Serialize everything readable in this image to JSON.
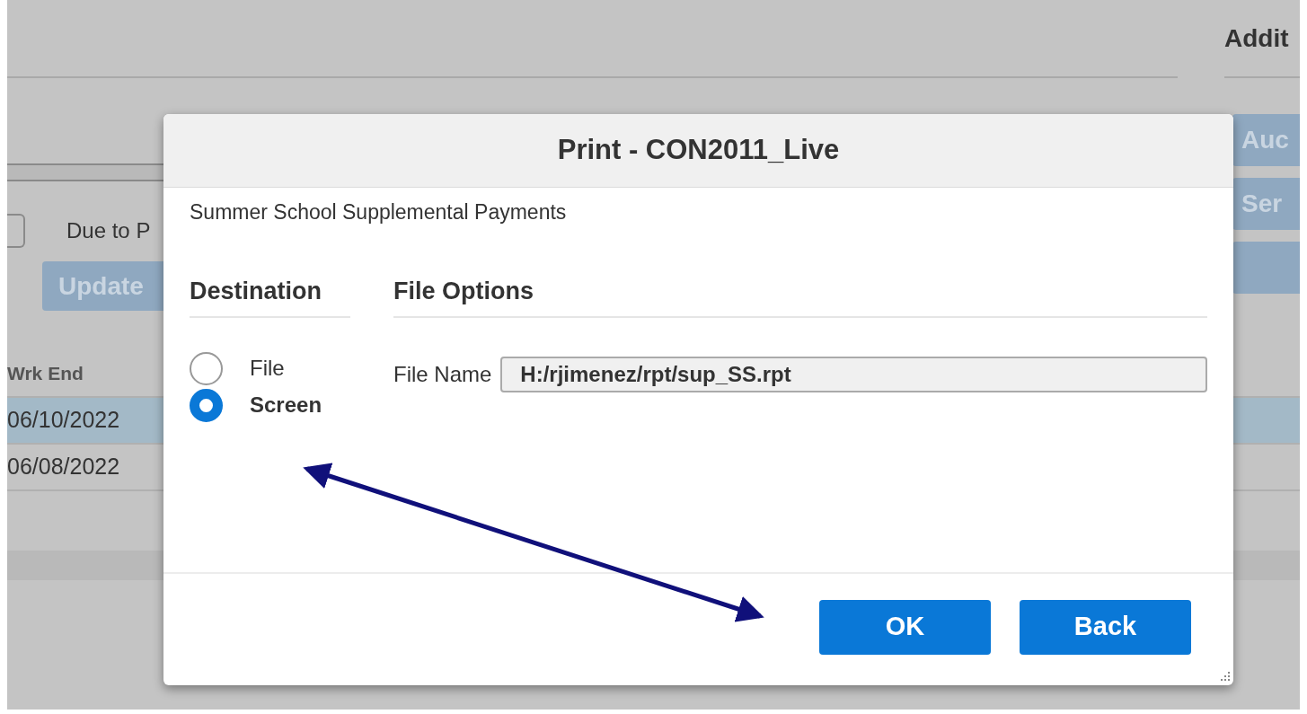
{
  "background": {
    "filter_label": "Due to P",
    "update_button": "Update",
    "section_title": "Addit",
    "side_buttons": [
      "Auc",
      "Ser"
    ],
    "table": {
      "columns": [
        "Wrk End"
      ],
      "rows": [
        {
          "cells": [
            "06/10/2022"
          ],
          "selected": true
        },
        {
          "cells": [
            "06/08/2022"
          ],
          "selected": false
        }
      ]
    }
  },
  "dialog": {
    "title": "Print - CON2011_Live",
    "report_name": "Summer School Supplemental Payments",
    "destination": {
      "heading": "Destination",
      "options": [
        {
          "label": "File",
          "selected": false
        },
        {
          "label": "Screen",
          "selected": true
        }
      ]
    },
    "file_options": {
      "heading": "File Options",
      "fields": [
        {
          "label": "File Name",
          "value": "H:/rjimenez/rpt/sup_SS.rpt"
        }
      ]
    },
    "buttons": [
      "OK",
      "Back"
    ]
  }
}
